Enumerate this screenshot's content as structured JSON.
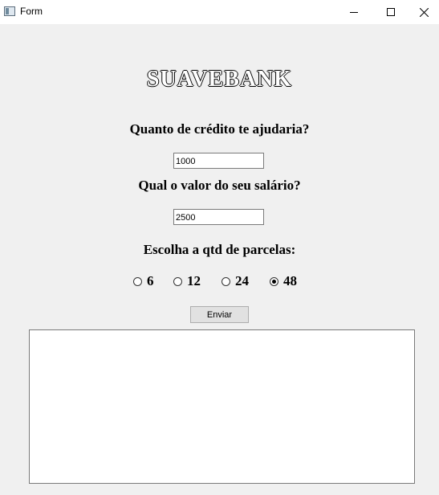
{
  "window": {
    "title": "Form"
  },
  "form": {
    "heading": "SUAVEBANK",
    "credit_question": "Quanto  de crédito te ajudaria?",
    "credit_value": "1000",
    "salary_question": "Qual o valor do seu salário?",
    "salary_value": "2500",
    "installments_question": "Escolha a qtd de parcelas:",
    "installment_options": [
      "6",
      "12",
      "24",
      "48"
    ],
    "selected_installment": "48",
    "submit_label": "Enviar",
    "output_text": ""
  }
}
